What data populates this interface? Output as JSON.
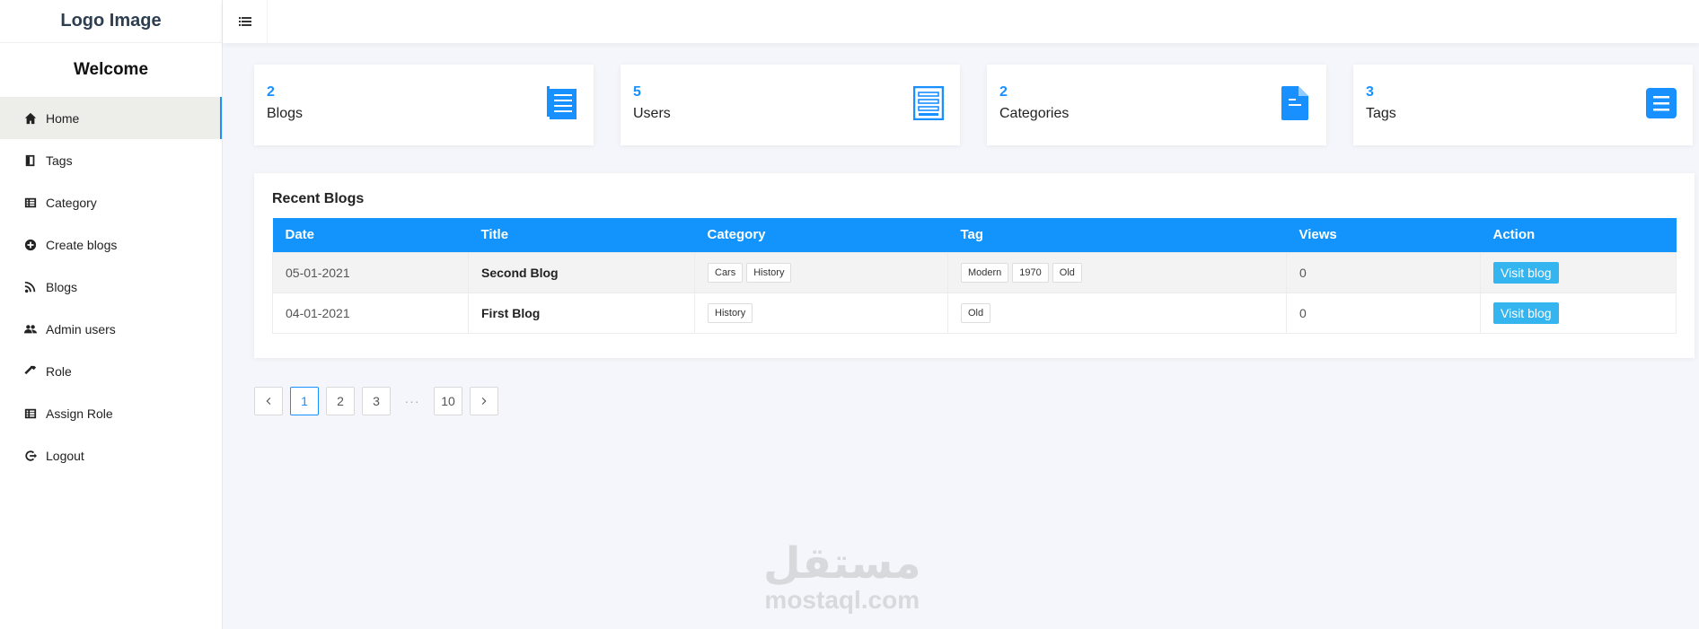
{
  "brand": {
    "logo": "Logo Image",
    "welcome": "Welcome"
  },
  "sidebar": {
    "items": [
      {
        "label": "Home",
        "icon": "home-icon",
        "active": true
      },
      {
        "label": "Tags",
        "icon": "book-icon"
      },
      {
        "label": "Category",
        "icon": "list-icon"
      },
      {
        "label": "Create blogs",
        "icon": "plus-circle-icon"
      },
      {
        "label": "Blogs",
        "icon": "rss-icon"
      },
      {
        "label": "Admin users",
        "icon": "users-icon"
      },
      {
        "label": "Role",
        "icon": "hammer-icon"
      },
      {
        "label": "Assign Role",
        "icon": "list-icon"
      },
      {
        "label": "Logout",
        "icon": "logout-icon"
      }
    ]
  },
  "stats": [
    {
      "count": "2",
      "label": "Blogs",
      "icon": "document-lines-icon"
    },
    {
      "count": "5",
      "label": "Users",
      "icon": "list-doc-icon"
    },
    {
      "count": "2",
      "label": "Categories",
      "icon": "file-icon"
    },
    {
      "count": "3",
      "label": "Tags",
      "icon": "menu-list-icon"
    }
  ],
  "recent": {
    "title": "Recent Blogs",
    "columns": [
      "Date",
      "Title",
      "Category",
      "Tag",
      "Views",
      "Action"
    ],
    "rows": [
      {
        "date": "05-01-2021",
        "title": "Second Blog",
        "categories": [
          "Cars",
          "History"
        ],
        "tags": [
          "Modern",
          "1970",
          "Old"
        ],
        "views": "0",
        "action": "Visit blog"
      },
      {
        "date": "04-01-2021",
        "title": "First Blog",
        "categories": [
          "History"
        ],
        "tags": [
          "Old"
        ],
        "views": "0",
        "action": "Visit blog"
      }
    ]
  },
  "pagination": {
    "pages": [
      "1",
      "2",
      "3"
    ],
    "ellipsis": "···",
    "last": "10",
    "current": "1"
  },
  "watermark": {
    "arabic": "مستقل",
    "latin": "mostaql.com"
  },
  "colors": {
    "accent": "#1890ff",
    "table_header": "#1394fc",
    "visit_button": "#35b5f0",
    "icon_blue": "#1890ff"
  }
}
